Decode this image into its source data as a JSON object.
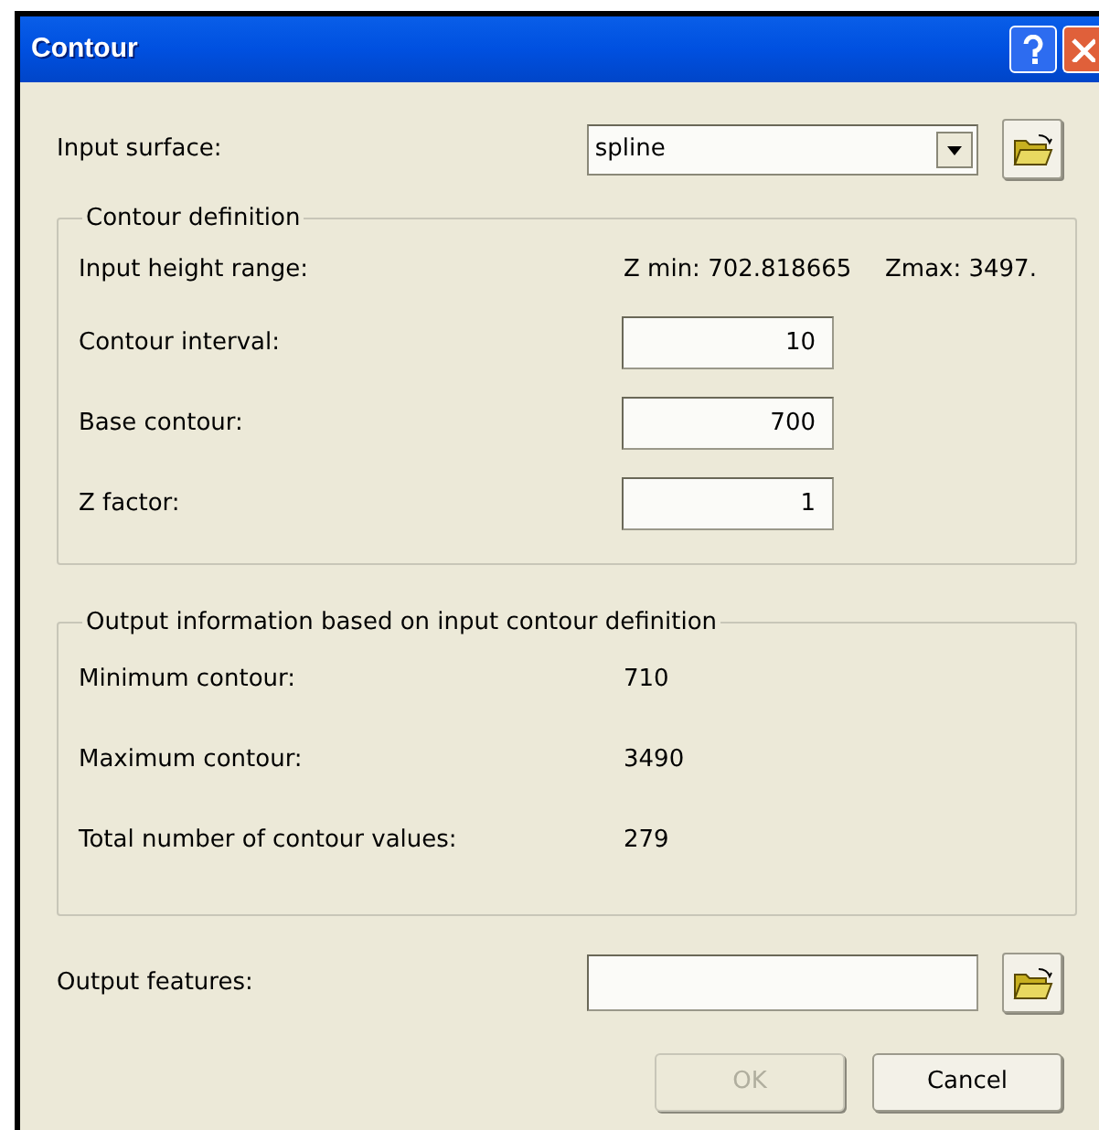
{
  "window": {
    "title": "Contour"
  },
  "input_surface": {
    "label": "Input surface:",
    "value": "spline"
  },
  "contour_definition": {
    "title": "Contour definition",
    "height_range": {
      "label": "Input height range:",
      "zmin": "Z min: 702.818665",
      "zmax": "Zmax: 3497."
    },
    "fields": [
      {
        "label": "Contour interval:",
        "value": "10"
      },
      {
        "label": "Base contour:",
        "value": "700"
      },
      {
        "label": "Z factor:",
        "value": "1"
      }
    ]
  },
  "output_information": {
    "title": "Output information based on input contour definition",
    "rows": [
      {
        "label": "Minimum contour:",
        "value": "710"
      },
      {
        "label": "Maximum contour:",
        "value": "3490"
      },
      {
        "label": "Total number of contour values:",
        "value": "279"
      }
    ]
  },
  "output_features": {
    "label": "Output features:"
  },
  "buttons": [
    {
      "label": "OK",
      "disabled": true
    },
    {
      "label": "Cancel",
      "disabled": false
    }
  ]
}
